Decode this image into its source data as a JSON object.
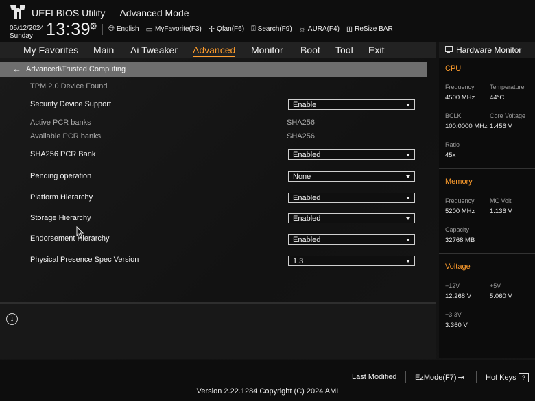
{
  "header": {
    "title": "UEFI BIOS Utility — Advanced Mode",
    "date": "05/12/2024",
    "day": "Sunday",
    "time": "13:39",
    "tools": [
      {
        "icon": "globe-icon",
        "label": "English"
      },
      {
        "icon": "favorite-icon",
        "label": "MyFavorite(F3)"
      },
      {
        "icon": "fan-icon",
        "label": "Qfan(F6)"
      },
      {
        "icon": "search-icon",
        "label": "Search(F9)"
      },
      {
        "icon": "aura-icon",
        "label": "AURA(F4)"
      },
      {
        "icon": "resize-bar-icon",
        "label": "ReSize BAR"
      }
    ]
  },
  "menu": {
    "tabs": [
      "My Favorites",
      "Main",
      "Ai Tweaker",
      "Advanced",
      "Monitor",
      "Boot",
      "Tool",
      "Exit"
    ],
    "active": "Advanced"
  },
  "breadcrumb": "Advanced\\Trusted Computing",
  "settings": {
    "tpm_found": "TPM 2.0 Device Found",
    "security_device_support": {
      "label": "Security Device Support",
      "value": "Enable"
    },
    "active_pcr_banks": {
      "label": "Active PCR banks",
      "value": "SHA256"
    },
    "available_pcr_banks": {
      "label": "Available PCR banks",
      "value": "SHA256"
    },
    "sha256_pcr_bank": {
      "label": "SHA256 PCR Bank",
      "value": "Enabled"
    },
    "pending_operation": {
      "label": "Pending operation",
      "value": "None"
    },
    "platform_hierarchy": {
      "label": "Platform Hierarchy",
      "value": "Enabled"
    },
    "storage_hierarchy": {
      "label": "Storage Hierarchy",
      "value": "Enabled"
    },
    "endorsement_hierarchy": {
      "label": "Endorsement Hierarchy",
      "value": "Enabled"
    },
    "physical_presence_spec_version": {
      "label": "Physical Presence Spec Version",
      "value": "1.3"
    }
  },
  "hardware_monitor": {
    "title": "Hardware Monitor",
    "cpu": {
      "title": "CPU",
      "frequency_label": "Frequency",
      "frequency": "4500 MHz",
      "temperature_label": "Temperature",
      "temperature": "44°C",
      "bclk_label": "BCLK",
      "bclk": "100.0000 MHz",
      "core_voltage_label": "Core Voltage",
      "core_voltage": "1.456 V",
      "ratio_label": "Ratio",
      "ratio": "45x"
    },
    "memory": {
      "title": "Memory",
      "frequency_label": "Frequency",
      "frequency": "5200 MHz",
      "mc_volt_label": "MC Volt",
      "mc_volt": "1.136 V",
      "capacity_label": "Capacity",
      "capacity": "32768 MB"
    },
    "voltage": {
      "title": "Voltage",
      "v12_label": "+12V",
      "v12": "12.268 V",
      "v5_label": "+5V",
      "v5": "5.060 V",
      "v33_label": "+3.3V",
      "v33": "3.360 V"
    }
  },
  "footer": {
    "last_modified": "Last Modified",
    "ezmode": "EzMode(F7)",
    "hotkeys": "Hot Keys",
    "version": "Version 2.22.1284 Copyright (C) 2024 AMI"
  }
}
